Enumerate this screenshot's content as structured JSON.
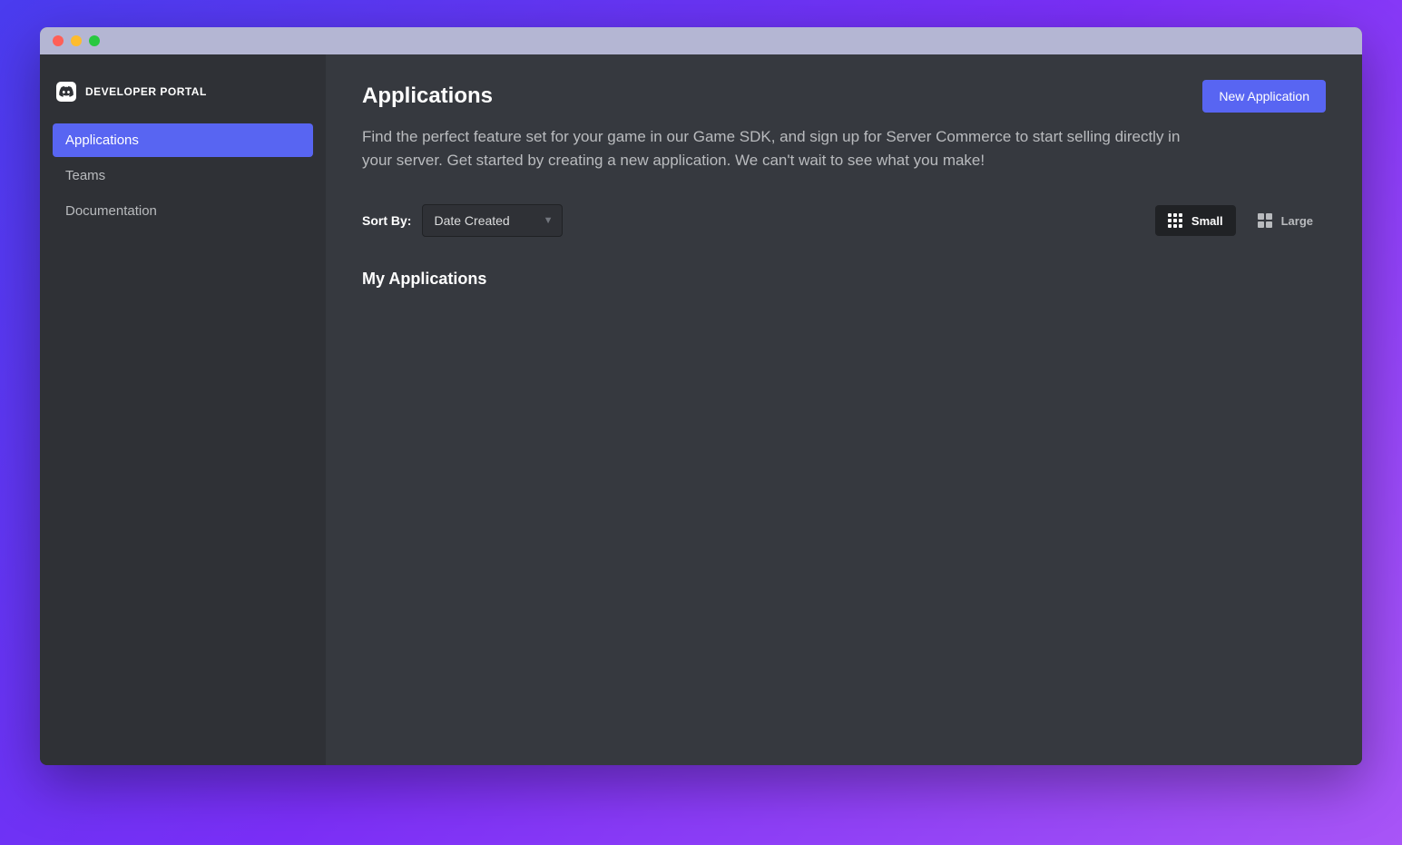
{
  "brand": {
    "label": "DEVELOPER PORTAL"
  },
  "sidebar": {
    "items": [
      {
        "label": "Applications",
        "active": true
      },
      {
        "label": "Teams",
        "active": false
      },
      {
        "label": "Documentation",
        "active": false
      }
    ]
  },
  "header": {
    "title": "Applications",
    "new_button": "New Application"
  },
  "description": "Find the perfect feature set for your game in our Game SDK, and sign up for Server Commerce to start selling directly in your server. Get started by creating a new application. We can't wait to see what you make!",
  "sort": {
    "label": "Sort By:",
    "selected": "Date Created"
  },
  "view": {
    "small": "Small",
    "large": "Large"
  },
  "section": {
    "my_applications": "My Applications"
  }
}
